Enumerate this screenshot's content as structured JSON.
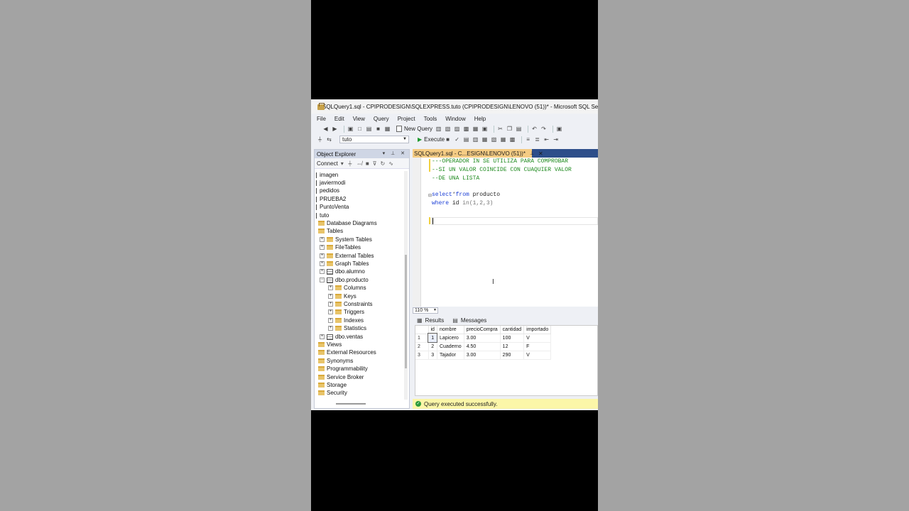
{
  "window": {
    "title": "SQLQuery1.sql - CPIPRODESIGN\\SQLEXPRESS.tuto (CPIPRODESIGN\\LENOVO (51))* - Microsoft SQL Server Management Studio"
  },
  "menu": [
    "File",
    "Edit",
    "View",
    "Query",
    "Project",
    "Tools",
    "Window",
    "Help"
  ],
  "toolbar": {
    "new_query_label": "New Query",
    "database": "tuto",
    "execute_label": "Execute"
  },
  "object_explorer": {
    "title": "Object Explorer",
    "connect_label": "Connect",
    "databases": [
      "imagen",
      "javiermodi",
      "pedidos",
      "PRUEBA2",
      "PuntoVenta",
      "tuto"
    ],
    "tuto_children": {
      "database_diagrams": "Database Diagrams",
      "tables": "Tables",
      "table_children": {
        "system_tables": "System Tables",
        "file_tables": "FileTables",
        "external_tables": "External Tables",
        "graph_tables": "Graph Tables",
        "alumno": "dbo.alumno",
        "producto": "dbo.producto",
        "producto_children": [
          "Columns",
          "Keys",
          "Constraints",
          "Triggers",
          "Indexes",
          "Statistics"
        ],
        "ventas": "dbo.ventas"
      },
      "views": "Views",
      "external_resources": "External Resources",
      "synonyms": "Synonyms",
      "programmability": "Programmability",
      "service_broker": "Service Broker",
      "storage": "Storage",
      "security": "Security"
    }
  },
  "editor": {
    "tab_label": "SQLQuery1.sql - C...ESIGN\\LENOVO (51))*",
    "lines": {
      "c1": "---OPERADOR IN SE UTILIZA PARA COMPROBAR",
      "c2": "--SI UN VALOR COINCIDE CON CUAQUIER VALOR",
      "c3": "--DE UNA LISTA",
      "select_kw": "select",
      "star": "*",
      "from_kw": "from",
      "table": " producto",
      "where_kw": "where",
      "where_col": " id ",
      "in_kw": "in",
      "in_list": "(1,2,3)"
    },
    "zoom": "110 %"
  },
  "results": {
    "tabs": {
      "results": "Results",
      "messages": "Messages"
    },
    "columns": [
      "id",
      "nombre",
      "precioCompra",
      "cantidad",
      "importado"
    ],
    "rows": [
      {
        "n": "1",
        "id": "1",
        "nombre": "Lapicero",
        "precioCompra": "3.00",
        "cantidad": "100",
        "importado": "V"
      },
      {
        "n": "2",
        "id": "2",
        "nombre": "Cuaderno",
        "precioCompra": "4.50",
        "cantidad": "12",
        "importado": "F"
      },
      {
        "n": "3",
        "id": "3",
        "nombre": "Tajador",
        "precioCompra": "3.00",
        "cantidad": "290",
        "importado": "V"
      }
    ]
  },
  "status": {
    "message": "Query executed successfully.",
    "color": "#fbf6a8"
  }
}
